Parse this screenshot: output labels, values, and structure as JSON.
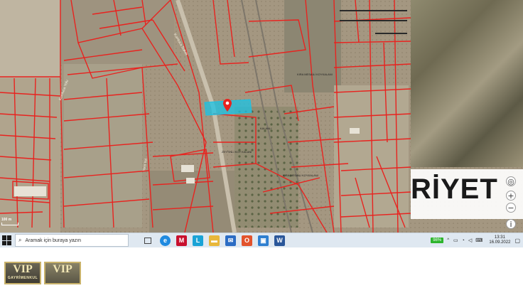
{
  "map": {
    "watermark_text": "RİYET",
    "parcel_labels": [
      "KIRA MESAİLİ KOYKALANI",
      "ZEYTİNLİ KOY KALANI",
      "KIRA MESAİLİ KOYKALANI",
      "KALANLI"
    ],
    "road_labels": [
      "Kumluca Yolu",
      "Kumluca Sokak",
      "Yeni Yol"
    ],
    "scale_label": "100 m",
    "controls": {
      "locate": "◎",
      "zoom_in": "+",
      "zoom_out": "−",
      "info": "i"
    },
    "colors": {
      "parcel_line": "#e8231f",
      "highlight": "#19c3e6",
      "pin": "#e8231f"
    }
  },
  "taskbar": {
    "search_placeholder": "Aramak için buraya yazın",
    "battery": "98%",
    "time": "13:31",
    "date": "16.09.2022",
    "apps": [
      {
        "name": "edge",
        "glyph": "e",
        "color": "#1f8ae0"
      },
      {
        "name": "mcafee",
        "glyph": "M",
        "color": "#c8102e"
      },
      {
        "name": "l-app",
        "glyph": "L",
        "color": "#1aa3d6"
      },
      {
        "name": "folder",
        "glyph": "▬",
        "color": "#e8b73a"
      },
      {
        "name": "mail",
        "glyph": "✉",
        "color": "#2b6cc4"
      },
      {
        "name": "office",
        "glyph": "O",
        "color": "#e2532d"
      },
      {
        "name": "photos",
        "glyph": "▣",
        "color": "#2e7fd0"
      },
      {
        "name": "word",
        "glyph": "W",
        "color": "#2b579a"
      }
    ]
  },
  "branding": {
    "logo1_big": "VIP",
    "logo1_small": "GAYRİMENKUL",
    "logo2_big": "VIP"
  }
}
